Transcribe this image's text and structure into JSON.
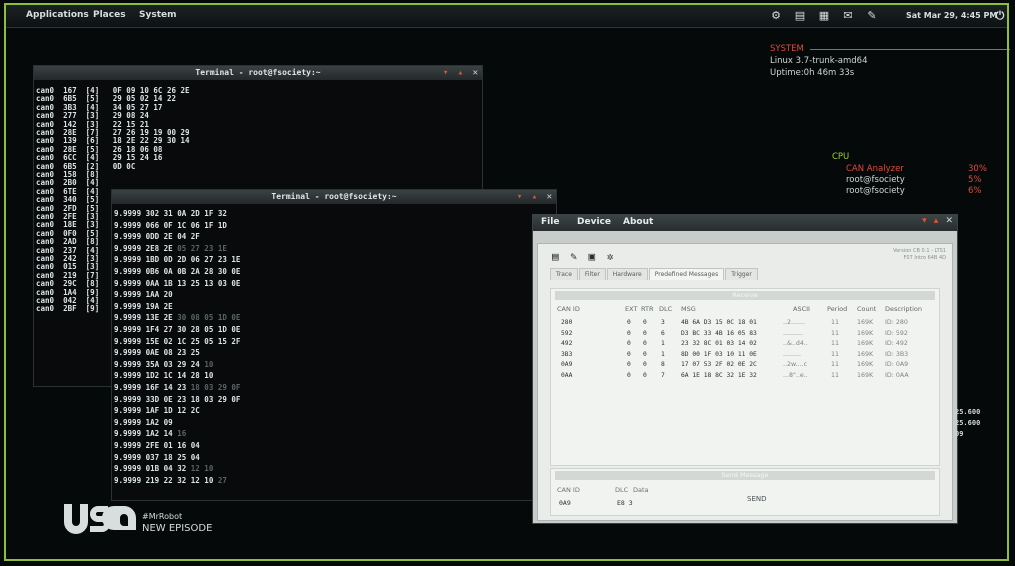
{
  "colors": {
    "accent_green": "#8fbf3a",
    "alert_red": "#e04a3a",
    "panel_bg": "#c8ccca"
  },
  "top_panel": {
    "menus": [
      "Applications",
      "Places",
      "System"
    ],
    "clock": "Sat Mar 29, 4:45 PM",
    "tray_icons": [
      "network-icon",
      "display-icon",
      "battery-icon",
      "mail-icon",
      "wrench-icon",
      "power-icon"
    ]
  },
  "system_info": {
    "title": "SYSTEM",
    "kernel": "Linux 3.7-trunk-amd64",
    "uptime": "Uptime:0h 46m 33s"
  },
  "cpu_info": {
    "label": "CPU",
    "processes": [
      {
        "name": "CAN Analyzer",
        "pct": "30%"
      },
      {
        "name": "root@fsociety",
        "pct": "5%"
      },
      {
        "name": "root@fsociety",
        "pct": "6%"
      }
    ]
  },
  "terminal1": {
    "title": "Terminal - root@fsociety:~",
    "lines": [
      [
        "can0",
        "167",
        "[4]",
        "0F 09 10 6C 26 2E",
        ""
      ],
      [
        "can0",
        "6B5",
        "[5]",
        "29 05 02 14 22",
        ""
      ],
      [
        "can0",
        "3B3",
        "[4]",
        "34 05 27 17",
        ""
      ],
      [
        "can0",
        "277",
        "[3]",
        "29 08 24",
        ""
      ],
      [
        "can0",
        "142",
        "[3]",
        "22 15 21",
        ""
      ],
      [
        "can0",
        "28E",
        "[7]",
        "27 26 19 19 00 29",
        ""
      ],
      [
        "can0",
        "139",
        "[6]",
        "18 2E 22 29 30 14",
        ""
      ],
      [
        "can0",
        "28E",
        "[5]",
        "26 18 06 08",
        ""
      ],
      [
        "can0",
        "6CC",
        "[4]",
        "29 15 24 16",
        ""
      ],
      [
        "can0",
        "6B5",
        "[2]",
        "0D 0C",
        ""
      ],
      [
        "can0",
        "158",
        "[8]",
        "",
        ""
      ],
      [
        "can0",
        "2B0",
        "[4]",
        "",
        ""
      ],
      [
        "can0",
        "6TE",
        "[4]",
        "",
        ""
      ],
      [
        "can0",
        "340",
        "[5]",
        "",
        ""
      ],
      [
        "can0",
        "2FD",
        "[5]",
        "",
        ""
      ],
      [
        "can0",
        "2FE",
        "[3]",
        "",
        ""
      ],
      [
        "can0",
        "18E",
        "[3]",
        "",
        ""
      ],
      [
        "can0",
        "0F0",
        "[5]",
        "",
        ""
      ],
      [
        "can0",
        "2AD",
        "[8]",
        "",
        ""
      ],
      [
        "can0",
        "237",
        "[4]",
        "",
        ""
      ],
      [
        "can0",
        "242",
        "[3]",
        "",
        ""
      ],
      [
        "can0",
        "015",
        "[3]",
        "",
        ""
      ],
      [
        "can0",
        "219",
        "[7]",
        "",
        ""
      ],
      [
        "can0",
        "29C",
        "[8]",
        "",
        ""
      ],
      [
        "can0",
        "1A4",
        "[9]",
        "",
        ""
      ],
      [
        "can0",
        "042",
        "[4]",
        "",
        ""
      ],
      [
        "can0",
        "2BF",
        "[9]",
        "",
        ""
      ]
    ]
  },
  "terminal2": {
    "title": "Terminal - root@fsociety:~",
    "lines": [
      [
        "9.9999",
        "302",
        "31 0A 2D 1F 32",
        ""
      ],
      [
        "9.9999",
        "066",
        "0F 1C 06 1F 1D",
        ""
      ],
      [
        "9.9999",
        "0DD",
        "2E 04 2F",
        ""
      ],
      [
        "9.9999",
        "2E8",
        "2E",
        "05 27 23 1E"
      ],
      [
        "9.9999",
        "1BD",
        "0D 2D 06 27 23 1E",
        ""
      ],
      [
        "9.9999",
        "0B6",
        "0A 0B 2A 28 30 0E",
        ""
      ],
      [
        "9.9999",
        "0AA",
        "1B 13 25 13 03 0E",
        ""
      ],
      [
        "9.9999",
        "1AA",
        "20",
        ""
      ],
      [
        "9.9999",
        "19A",
        "2E",
        "",
        ""
      ],
      [
        "9.9999",
        "13E",
        "2E",
        "30 08 05 1D 0E"
      ],
      [
        "9.9999",
        "1F4",
        "27 30 28 05 1D 0E",
        ""
      ],
      [
        "9.9999",
        "15E",
        "02 1C 25 05 15 2F",
        ""
      ],
      [
        "9.9999",
        "0AE",
        "08 23 25",
        ""
      ],
      [
        "9.9999",
        "35A",
        "03 29 24",
        "10"
      ],
      [
        "9.9999",
        "1D2",
        "1C 14 28 10",
        ""
      ],
      [
        "9.9999",
        "16F",
        "14 23",
        "18 03 29 0F"
      ],
      [
        "9.9999",
        "33D",
        "0E 23 18 03 29 0F",
        ""
      ],
      [
        "9.9999",
        "1AF",
        "1D 12 2C",
        ""
      ],
      [
        "9.9999",
        "1A2",
        "09",
        ""
      ],
      [
        "9.9999",
        "1A2",
        "14",
        "16"
      ],
      [
        "9.9999",
        "2FE",
        "01 16 04",
        ""
      ],
      [
        "9.9999",
        "037",
        "18 25 04",
        ""
      ],
      [
        "9.9999",
        "01B",
        "04 32",
        "12 10"
      ],
      [
        "9.9999",
        "219",
        "22 32 12 10",
        "27"
      ]
    ]
  },
  "analyzer": {
    "menus": [
      "File",
      "Device",
      "About"
    ],
    "version": "Version CB 0.1 - LTS1 F07 Intro 64B 4D",
    "toolbar_icons": [
      "document-icon",
      "tools-icon",
      "save-icon",
      "settings-icon"
    ],
    "tabs": [
      "Trace",
      "Filter",
      "Hardware",
      "Predefined Messages",
      "Trigger"
    ],
    "receive_title": "Receive",
    "columns": [
      "CAN ID",
      "EXT",
      "RTR",
      "DLC",
      "MSG",
      "ASCII",
      "Period",
      "Count",
      "Description"
    ],
    "rows": [
      {
        "id": "280",
        "ext": "0",
        "rtr": "0",
        "dlc": "3",
        "msg": "4B 6A D3 15 0C 18 01",
        "ascii": "..2.......",
        "period": "11",
        "count": "169K",
        "desc": "ID: 280"
      },
      {
        "id": "592",
        "ext": "0",
        "rtr": "0",
        "dlc": "6",
        "msg": "D3 BC 33 4B 16 05 83",
        "ascii": "..........",
        "period": "11",
        "count": "169K",
        "desc": "ID: 592"
      },
      {
        "id": "492",
        "ext": "0",
        "rtr": "0",
        "dlc": "1",
        "msg": "23 32 8C 01 03 14 02",
        "ascii": "..&..d4..",
        "period": "11",
        "count": "169K",
        "desc": "ID: 492"
      },
      {
        "id": "3B3",
        "ext": "0",
        "rtr": "0",
        "dlc": "1",
        "msg": "8D 00 1F 03 10 11 0E",
        "ascii": ".........",
        "period": "11",
        "count": "169K",
        "desc": "ID: 3B3"
      },
      {
        "id": "0A9",
        "ext": "0",
        "rtr": "0",
        "dlc": "8",
        "msg": "17 07 53 2F 02 0E 2C",
        "ascii": "..2w....c",
        "period": "11",
        "count": "169K",
        "desc": "ID: 0A9"
      },
      {
        "id": "0AA",
        "ext": "0",
        "rtr": "0",
        "dlc": "7",
        "msg": "6A 1E 18 8C 32 1E 32",
        "ascii": "...8\"..e..",
        "period": "11",
        "count": "169K",
        "desc": "ID: 0AA"
      }
    ],
    "send_title": "Send Message",
    "send_can_id_label": "CAN ID",
    "send_dlc_label": "DLC",
    "send_data_label": "Data",
    "send_can_id": "0A9",
    "send_dlc": "E8 3",
    "send_button": "SEND"
  },
  "edge_numbers": [
    "25.600",
    "25.600",
    "09"
  ],
  "watermark": {
    "logo": "usa",
    "hashtag": "#MrRobot",
    "tagline": "NEW EPISODE"
  }
}
